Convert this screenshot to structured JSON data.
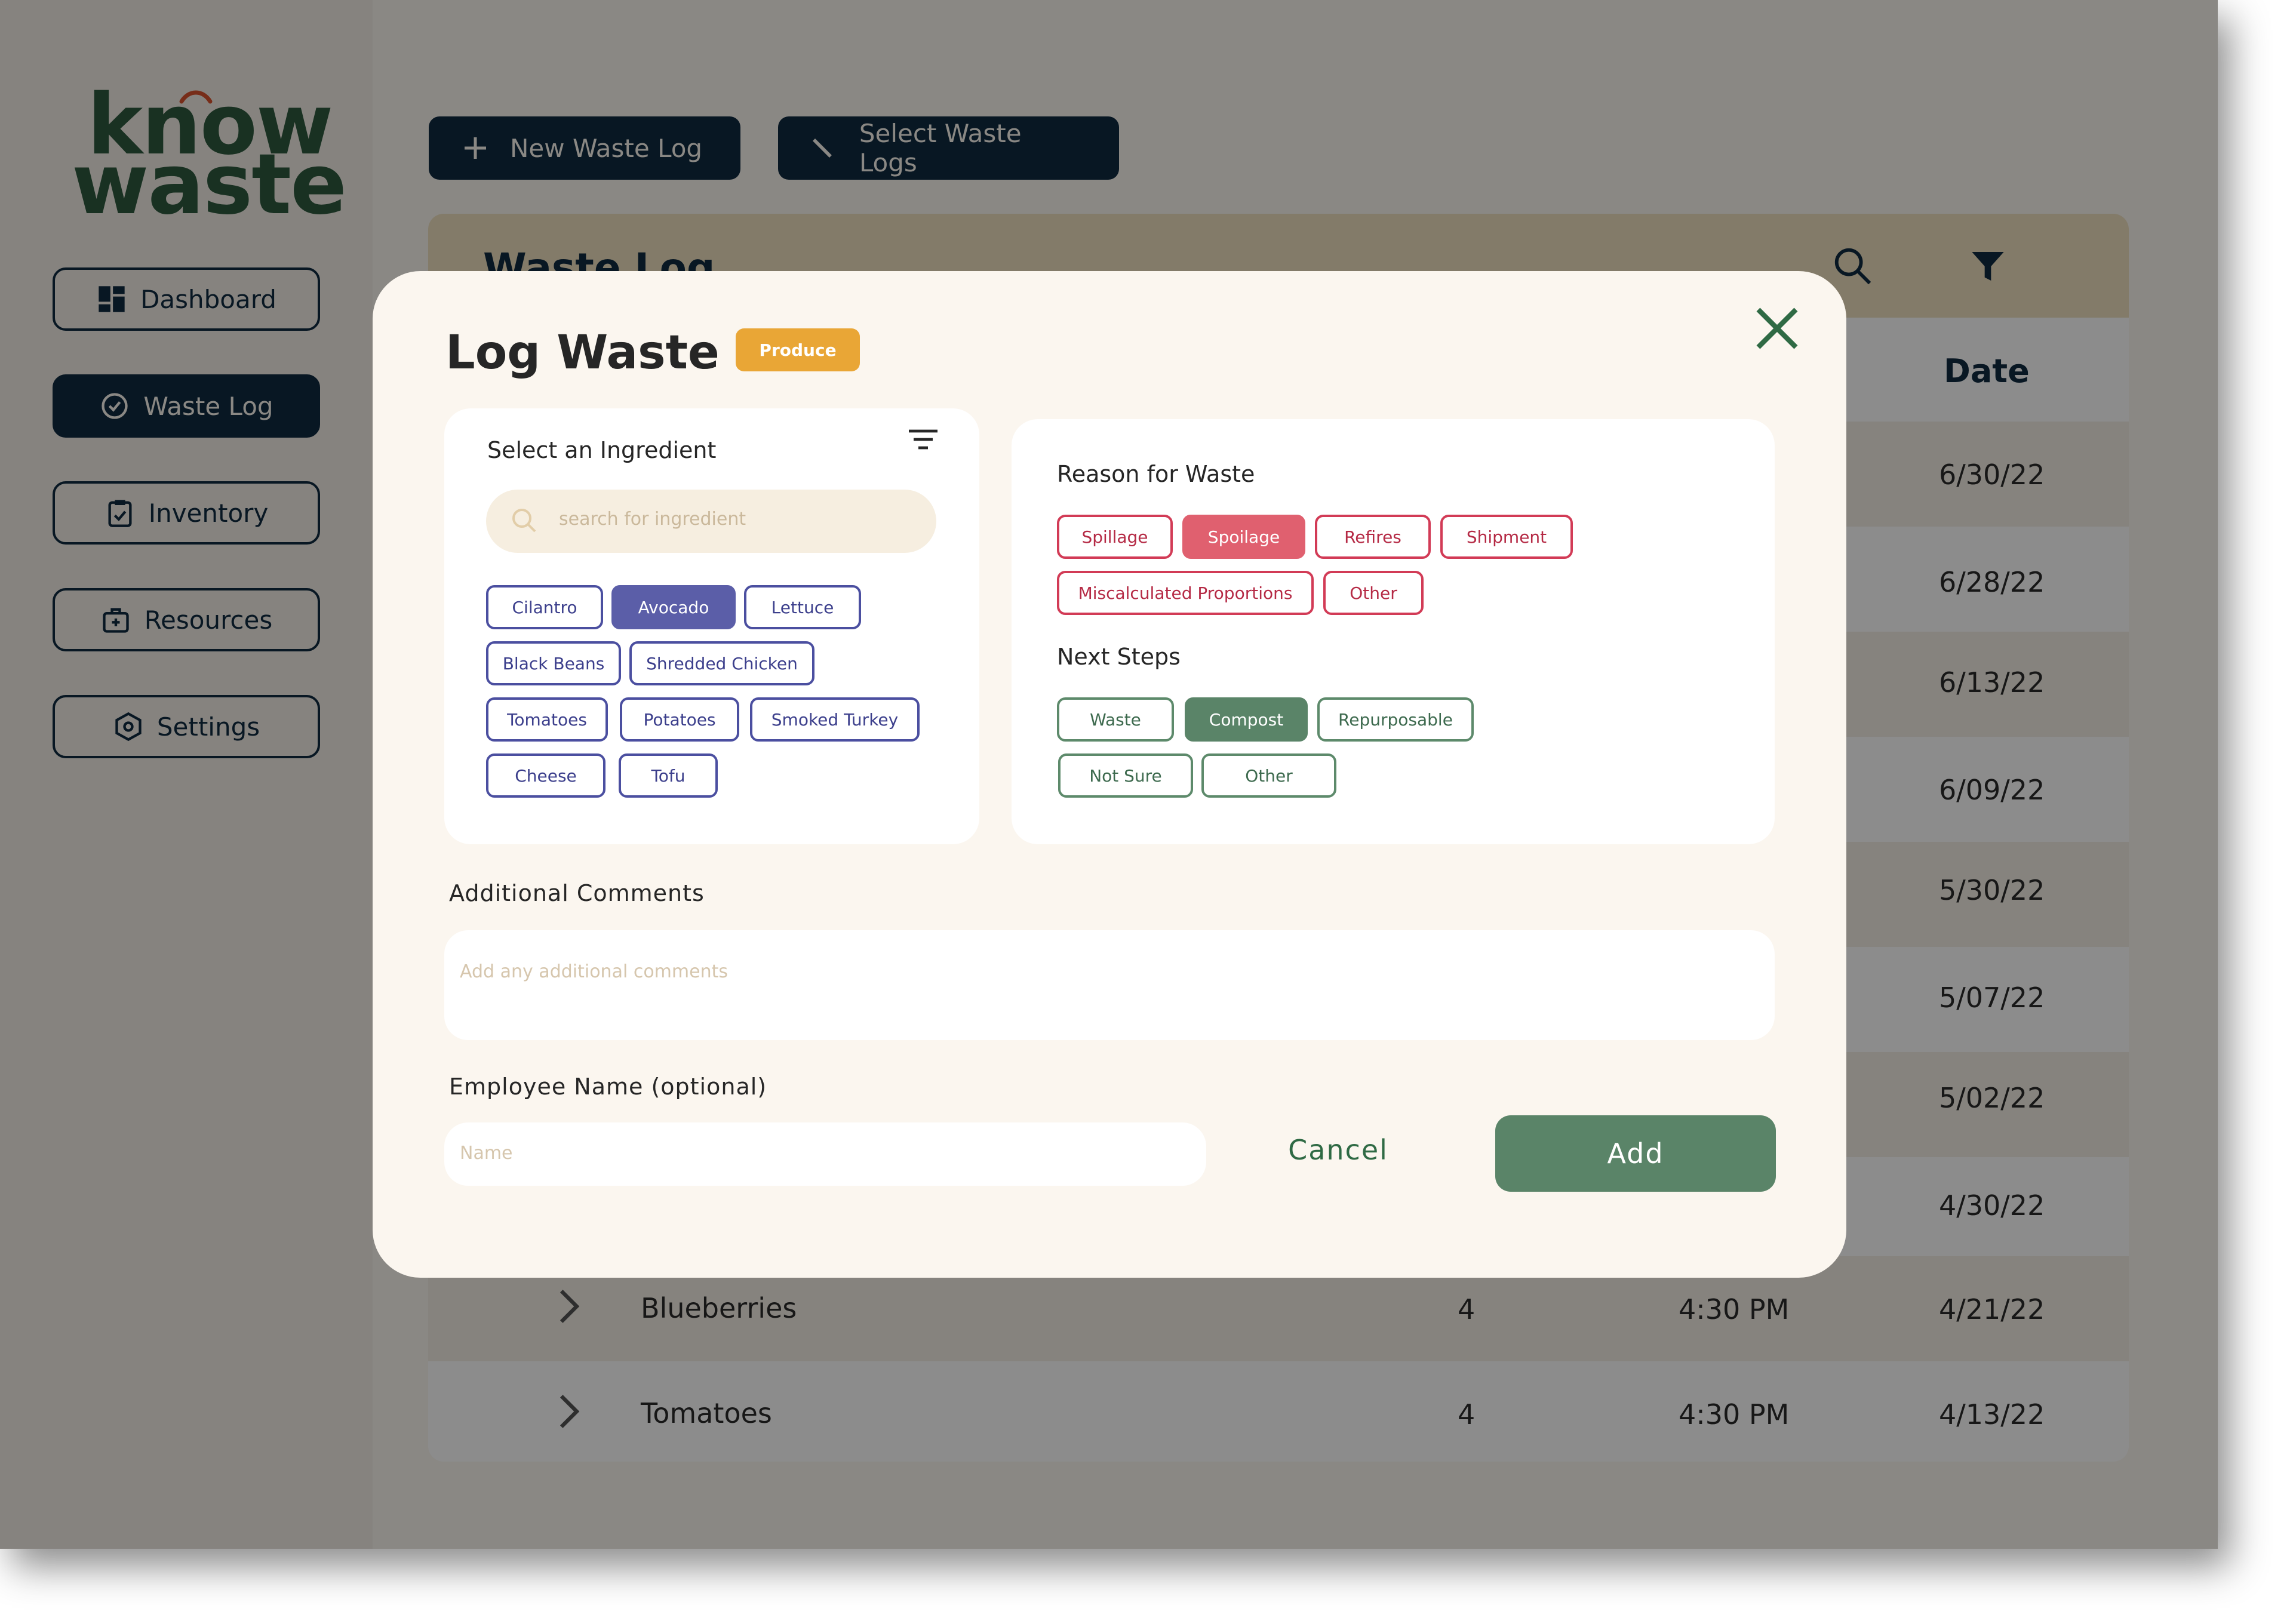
{
  "app": {
    "logo_line1": "know",
    "logo_line2": "waste"
  },
  "sidebar": {
    "items": [
      {
        "label": "Dashboard",
        "icon": "dashboard-icon"
      },
      {
        "label": "Waste Log",
        "icon": "clock-check-icon",
        "active": true
      },
      {
        "label": "Inventory",
        "icon": "clipboard-icon"
      },
      {
        "label": "Resources",
        "icon": "briefcase-plus-icon"
      },
      {
        "label": "Settings",
        "icon": "hexagon-gear-icon"
      }
    ]
  },
  "toolbar": {
    "new_log_label": "New Waste Log",
    "select_logs_label": "Select Waste Logs"
  },
  "table": {
    "title": "Waste Log",
    "date_header": "Date",
    "dates": [
      "6/30/22",
      "6/28/22",
      "6/13/22",
      "6/09/22",
      "5/30/22",
      "5/07/22",
      "5/02/22",
      "4/30/22"
    ],
    "rows": [
      {
        "item": "Blueberries",
        "qty": "4",
        "time": "4:30 PM",
        "date": "4/21/22"
      },
      {
        "item": "Tomatoes",
        "qty": "4",
        "time": "4:30 PM",
        "date": "4/13/22"
      }
    ]
  },
  "modal": {
    "title": "Log Waste",
    "category_badge": "Produce",
    "ingredient_label": "Select an Ingredient",
    "search_placeholder": "search for ingredient",
    "ingredients": [
      {
        "label": "Cilantro",
        "selected": false
      },
      {
        "label": "Avocado",
        "selected": true
      },
      {
        "label": "Lettuce",
        "selected": false
      },
      {
        "label": "Black Beans",
        "selected": false
      },
      {
        "label": "Shredded Chicken",
        "selected": false
      },
      {
        "label": "Tomatoes",
        "selected": false
      },
      {
        "label": "Potatoes",
        "selected": false
      },
      {
        "label": "Smoked Turkey",
        "selected": false
      },
      {
        "label": "Cheese",
        "selected": false
      },
      {
        "label": "Tofu",
        "selected": false
      }
    ],
    "reason_label": "Reason for Waste",
    "reasons": [
      {
        "label": "Spillage",
        "selected": false
      },
      {
        "label": "Spoilage",
        "selected": true
      },
      {
        "label": "Refires",
        "selected": false
      },
      {
        "label": "Shipment",
        "selected": false
      },
      {
        "label": "Miscalculated Proportions",
        "selected": false
      },
      {
        "label": "Other",
        "selected": false
      }
    ],
    "next_steps_label": "Next Steps",
    "next_steps": [
      {
        "label": "Waste",
        "selected": false
      },
      {
        "label": "Compost",
        "selected": true
      },
      {
        "label": "Repurposable",
        "selected": false
      },
      {
        "label": "Not Sure",
        "selected": false
      },
      {
        "label": "Other",
        "selected": false
      }
    ],
    "comments_label": "Additional Comments",
    "comments_placeholder": "Add any additional comments",
    "employee_label": "Employee Name (optional)",
    "employee_placeholder": "Name",
    "cancel_label": "Cancel",
    "add_label": "Add"
  },
  "colors": {
    "navy": "#0f2a40",
    "brand_green": "#2f5a3f",
    "badge_orange": "#e9a636",
    "ingredient_purple": "#5b5ea8",
    "reason_red": "#d23b56",
    "step_green": "#5a8468"
  }
}
